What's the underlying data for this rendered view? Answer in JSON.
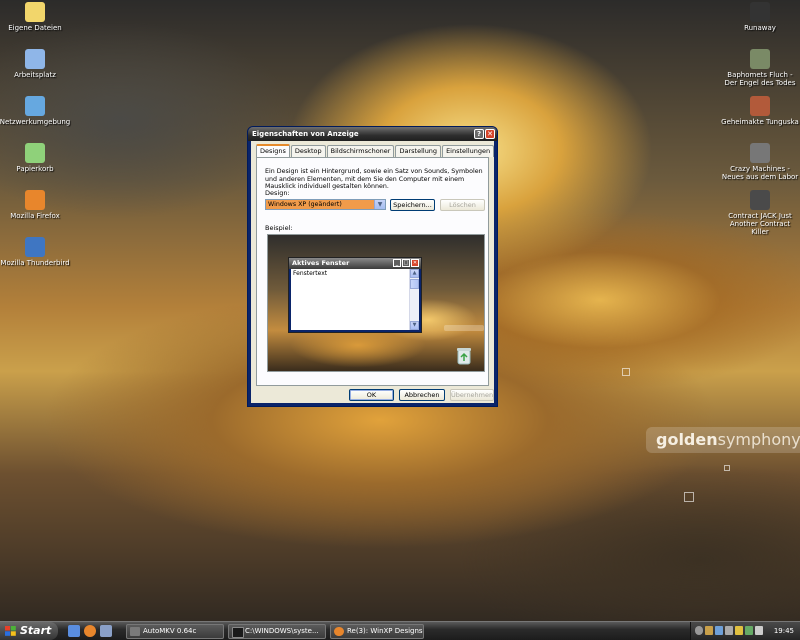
{
  "desktop_left": [
    {
      "name": "eigene-dateien",
      "label": "Eigene Dateien",
      "color": "#f2d66b"
    },
    {
      "name": "arbeitsplatz",
      "label": "Arbeitsplatz",
      "color": "#8fb6e8"
    },
    {
      "name": "netzwerkumgebung",
      "label": "Netzwerkumgebung",
      "color": "#66a8e0"
    },
    {
      "name": "papierkorb",
      "label": "Papierkorb",
      "color": "#8fd17a"
    },
    {
      "name": "mozilla-firefox",
      "label": "Mozilla Firefox",
      "color": "#e8862c"
    },
    {
      "name": "mozilla-thunderbird",
      "label": "Mozilla Thunderbird",
      "color": "#3f76c2"
    }
  ],
  "desktop_right": [
    {
      "name": "runaway",
      "label": "Runaway",
      "color": "#333333"
    },
    {
      "name": "baphomets-fluch",
      "label": "Baphomets Fluch - Der Engel des Todes",
      "color": "#7a8a66"
    },
    {
      "name": "geheimakte-tunguska",
      "label": "Geheimakte Tunguska",
      "color": "#b25a3a"
    },
    {
      "name": "crazy-machines",
      "label": "Crazy Machines - Neues aus dem Labor",
      "color": "#777777"
    },
    {
      "name": "contract-jack",
      "label": "Contract JACK Just Another Contract Killer",
      "color": "#4a4a4a"
    }
  ],
  "brand": {
    "bold": "golden",
    "light": "symphony"
  },
  "dialog": {
    "title": "Eigenschaften von Anzeige",
    "help": "?",
    "close": "✕",
    "tabs": [
      "Designs",
      "Desktop",
      "Bildschirmschoner",
      "Darstellung",
      "Einstellungen"
    ],
    "description": "Ein Design ist ein Hintergrund, sowie ein Satz von Sounds, Symbolen und anderen Elementen, mit dem Sie den Computer mit einem Mausklick individuell gestalten können.",
    "design_label": "Design:",
    "design_value": "Windows XP (geändert)",
    "save_button": "Speichern...",
    "delete_button": "Löschen",
    "example_label": "Beispiel:",
    "preview_window_title": "Aktives Fenster",
    "preview_window_text": "Fenstertext",
    "ok_button": "OK",
    "cancel_button": "Abbrechen",
    "apply_button": "Übernehmen"
  },
  "taskbar": {
    "start": "Start",
    "tasks": [
      {
        "label": "AutoMKV 0.64c",
        "color": "#7a7a7a"
      },
      {
        "label": "C:\\WINDOWS\\syste...",
        "color": "#1a1a1a"
      },
      {
        "label": "Re(3): WinXP Designs...",
        "color": "#e8862c"
      }
    ],
    "clock": "19:45"
  }
}
